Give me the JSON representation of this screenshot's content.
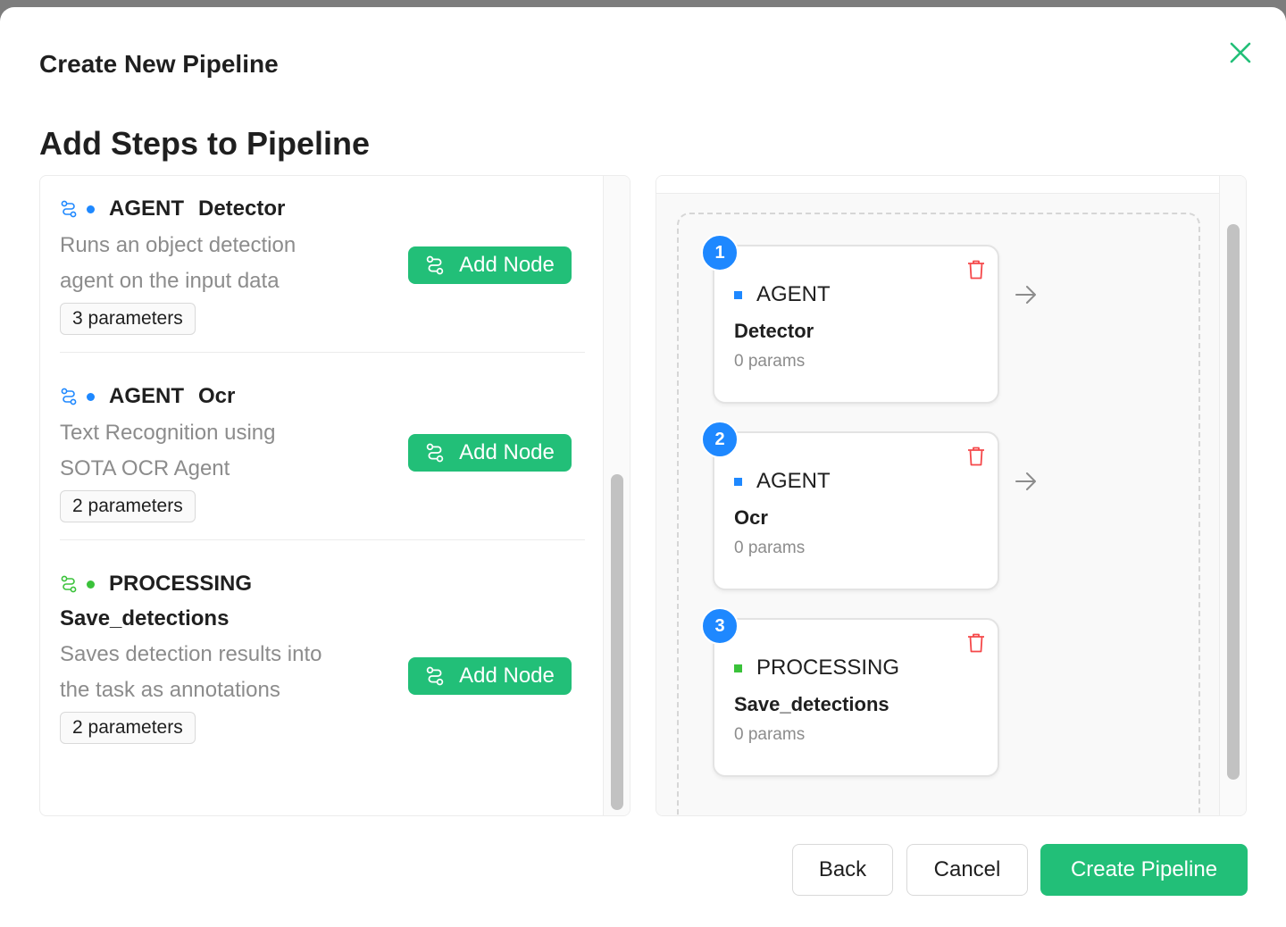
{
  "modal": {
    "title": "Create New Pipeline",
    "section_title": "Add Steps to Pipeline"
  },
  "available_nodes": [
    {
      "type": "AGENT",
      "name": "Detector",
      "description": "Runs an object detection agent on the input data",
      "params_label": "3 parameters",
      "add_label": "Add Node",
      "dot_color": "#1e88ff",
      "icon_color": "#1e88ff"
    },
    {
      "type": "AGENT",
      "name": "Ocr",
      "description": "Text Recognition using SOTA OCR Agent",
      "params_label": "2 parameters",
      "add_label": "Add Node",
      "dot_color": "#1e88ff",
      "icon_color": "#1e88ff"
    },
    {
      "type": "PROCESSING",
      "name": "Save_detections",
      "description": "Saves detection results into the task as annotations",
      "params_label": "2 parameters",
      "add_label": "Add Node",
      "dot_color": "#3ac23a",
      "icon_color": "#3ac23a"
    }
  ],
  "pipeline_steps": [
    {
      "number": "1",
      "type": "AGENT",
      "name": "Detector",
      "params": "0 params",
      "dot_color": "#1e88ff"
    },
    {
      "number": "2",
      "type": "AGENT",
      "name": "Ocr",
      "params": "0 params",
      "dot_color": "#1e88ff"
    },
    {
      "number": "3",
      "type": "PROCESSING",
      "name": "Save_detections",
      "params": "0 params",
      "dot_color": "#3ac23a"
    }
  ],
  "footer": {
    "back_label": "Back",
    "cancel_label": "Cancel",
    "create_label": "Create Pipeline"
  },
  "colors": {
    "accent": "#22bf78",
    "agent": "#1e88ff",
    "processing": "#3ac23a",
    "delete": "#f5484a"
  },
  "icons": {
    "close": "close-icon",
    "node": "flow-icon",
    "delete": "trash-icon",
    "next": "arrow-right-icon"
  }
}
